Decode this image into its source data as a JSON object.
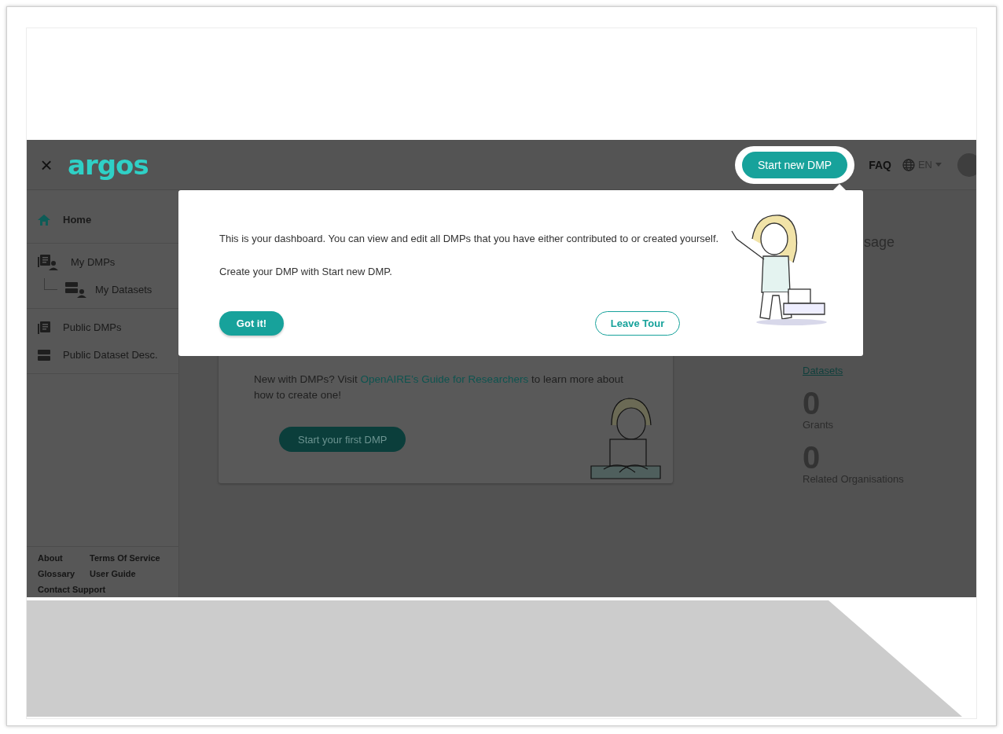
{
  "header": {
    "close_icon": "×",
    "logo": "argos",
    "start_button": "Start new DMP",
    "faq": "FAQ",
    "language": "EN"
  },
  "sidebar": {
    "groups": [
      {
        "items": [
          {
            "label": "Home",
            "kind": "home",
            "selected": true
          }
        ]
      },
      {
        "items": [
          {
            "label": "My DMPs",
            "kind": "dmps-user",
            "selected": false,
            "children": [
              {
                "label": "My Datasets",
                "kind": "datasets-user",
                "selected": false
              }
            ]
          }
        ]
      },
      {
        "items": [
          {
            "label": "Public DMPs",
            "kind": "dmps",
            "selected": false
          },
          {
            "label": "Public Dataset Desc.",
            "kind": "datasets",
            "selected": false
          }
        ]
      }
    ],
    "footer_links": [
      "About",
      "Terms Of Service",
      "Glossary",
      "User Guide",
      "Contact Support"
    ]
  },
  "main": {
    "intro_before": "New with DMPs? Visit ",
    "intro_link": "OpenAIRE’s Guide for Researchers",
    "intro_after": " to learn more about how to create one!",
    "start_first_button": "Start your first DMP"
  },
  "stats": {
    "heading": "sage",
    "items": [
      {
        "kind": "link",
        "label": "Datasets"
      },
      {
        "kind": "count",
        "value": "0",
        "label": "Grants"
      },
      {
        "kind": "count",
        "value": "0",
        "label": "Related Organisations"
      }
    ]
  },
  "tour": {
    "paragraphs": [
      "This is your dashboard. You can view and edit all DMPs that you have either contributed to or created yourself.",
      "Create your DMP with Start new DMP."
    ],
    "primary": "Got it!",
    "secondary": "Leave Tour"
  }
}
